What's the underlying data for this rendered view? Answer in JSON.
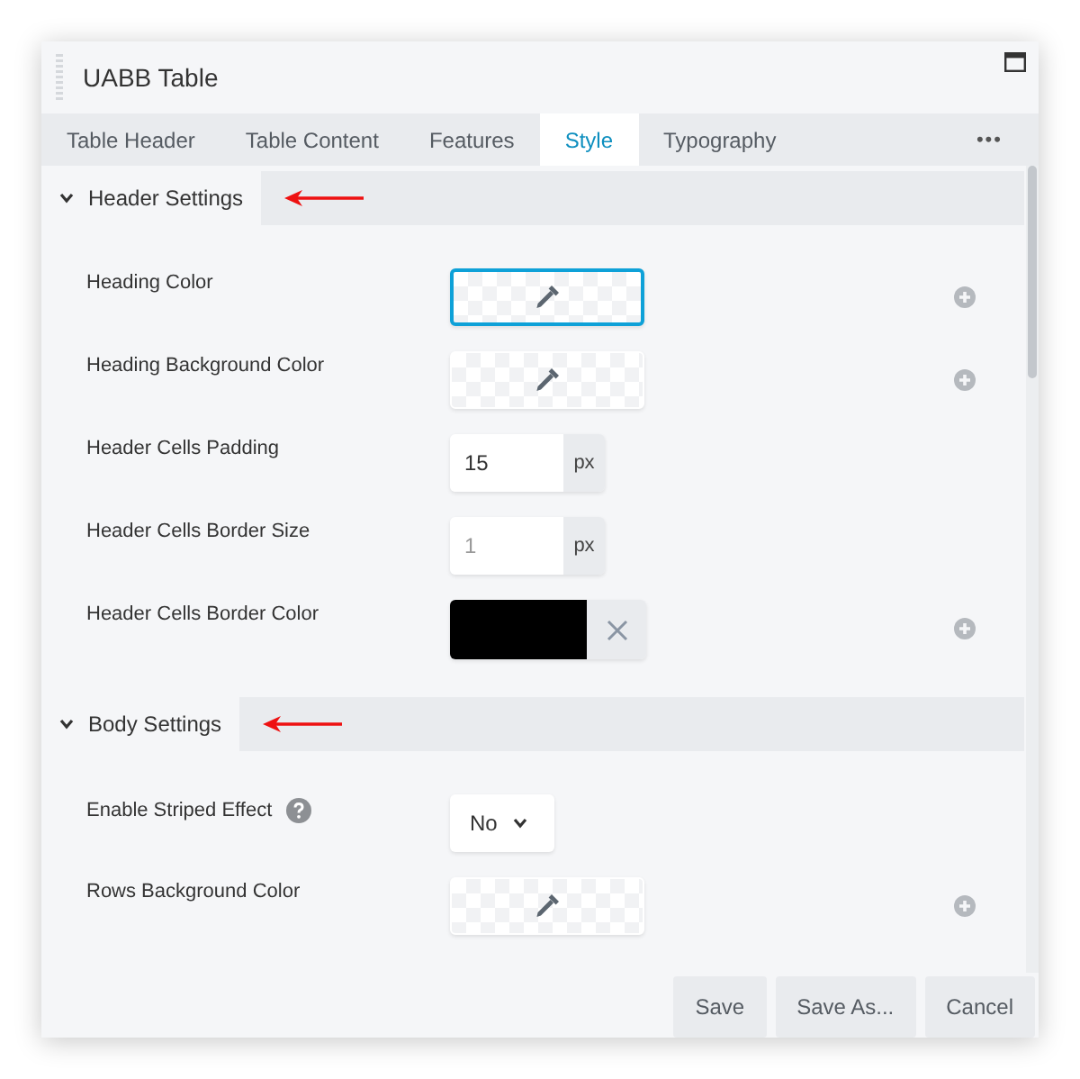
{
  "window": {
    "title": "UABB Table"
  },
  "tabs": [
    {
      "label": "Table Header",
      "selected": false
    },
    {
      "label": "Table Content",
      "selected": false
    },
    {
      "label": "Features",
      "selected": false
    },
    {
      "label": "Style",
      "selected": true
    },
    {
      "label": "Typography",
      "selected": false
    }
  ],
  "more_menu": "•••",
  "sections": [
    {
      "title": "Header Settings",
      "expanded": true,
      "arrow_marker": true,
      "fields": [
        {
          "label": "Heading Color",
          "kind": "color",
          "focused": true,
          "responsive": true
        },
        {
          "label": "Heading Background Color",
          "kind": "color",
          "focused": false,
          "responsive": true
        },
        {
          "label": "Header Cells Padding",
          "kind": "unit",
          "value": "15",
          "unit": "px",
          "responsive": false
        },
        {
          "label": "Header Cells Border Size",
          "kind": "unit",
          "placeholder": "1",
          "unit": "px",
          "responsive": false
        },
        {
          "label": "Header Cells Border Color",
          "kind": "swatch",
          "color": "#000000",
          "responsive": true
        }
      ]
    },
    {
      "title": "Body Settings",
      "expanded": true,
      "arrow_marker": true,
      "fields": [
        {
          "label": "Enable Striped Effect",
          "kind": "select",
          "value": "No",
          "help": true,
          "responsive": false
        },
        {
          "label": "Rows Background Color",
          "kind": "color",
          "focused": false,
          "responsive": true
        }
      ]
    }
  ],
  "buttons": [
    "Save",
    "Save As...",
    "Cancel"
  ]
}
